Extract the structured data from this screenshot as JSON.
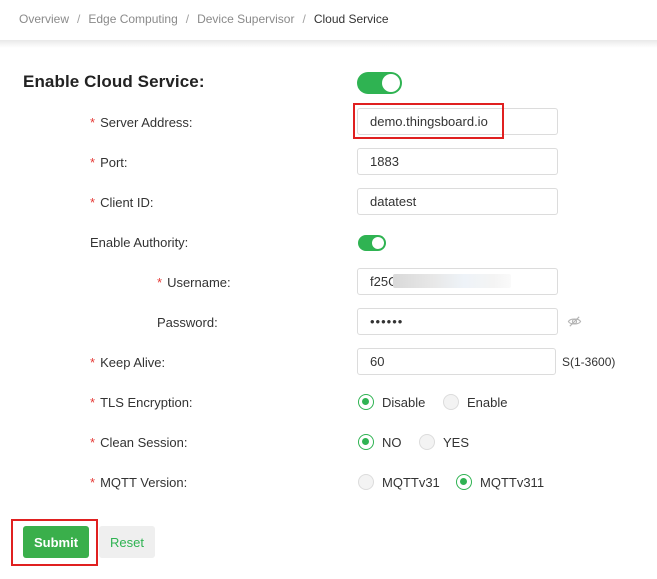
{
  "breadcrumb": [
    "Overview",
    "Edge Computing",
    "Device Supervisor",
    "Cloud Service"
  ],
  "form": {
    "title": "Enable Cloud Service:",
    "enabled": true,
    "server_address": {
      "label": "Server Address:",
      "value": "demo.thingsboard.io",
      "required": true
    },
    "port": {
      "label": "Port:",
      "value": "1883",
      "required": true
    },
    "client_id": {
      "label": "Client ID:",
      "value": "datatest",
      "required": true
    },
    "enable_authority": {
      "label": "Enable Authority:",
      "enabled": true
    },
    "username": {
      "label": "Username:",
      "value": "f25G",
      "required": true
    },
    "password": {
      "label": "Password:",
      "value": "••••••"
    },
    "keep_alive": {
      "label": "Keep Alive:",
      "value": "60",
      "suffix": "S(1-3600)",
      "required": true
    },
    "tls_encryption": {
      "label": "TLS Encryption:",
      "options": [
        "Disable",
        "Enable"
      ],
      "selected": "Disable",
      "required": true
    },
    "clean_session": {
      "label": "Clean Session:",
      "options": [
        "NO",
        "YES"
      ],
      "selected": "NO",
      "required": true
    },
    "mqtt_version": {
      "label": "MQTT Version:",
      "options": [
        "MQTTv31",
        "MQTTv311"
      ],
      "selected": "MQTTv311",
      "required": true
    }
  },
  "buttons": {
    "submit": "Submit",
    "reset": "Reset"
  },
  "colors": {
    "accent": "#2fb352",
    "required": "#e53935",
    "highlight": "#e02020"
  },
  "icons": {
    "password_visibility": "eye-slash-icon"
  }
}
